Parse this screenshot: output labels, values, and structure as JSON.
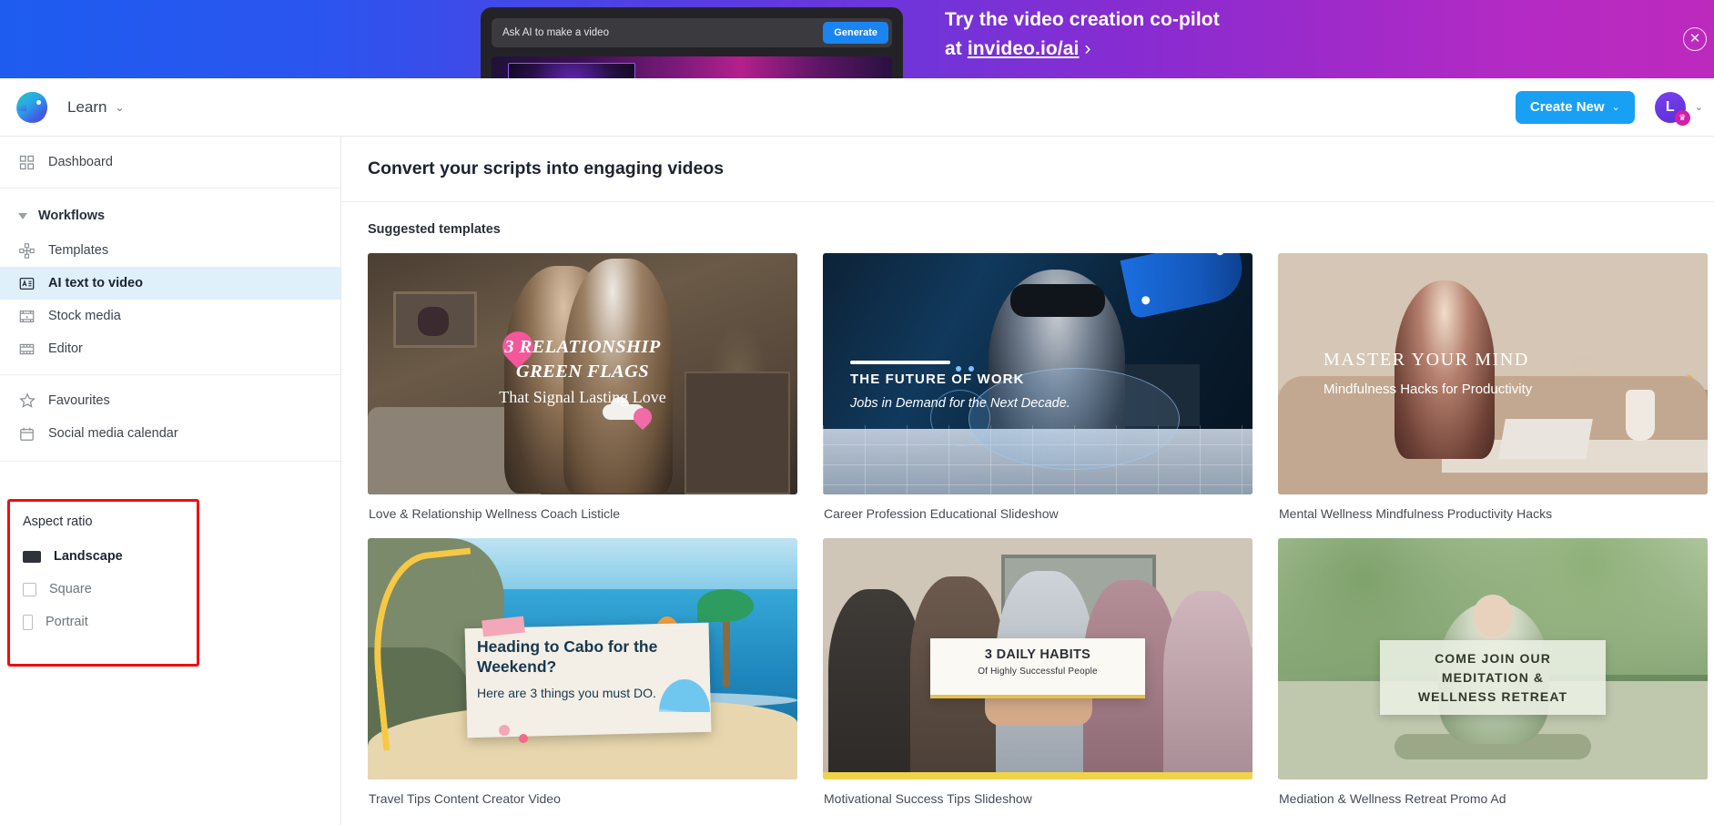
{
  "promo": {
    "prompt_placeholder": "Ask AI to make a video",
    "generate_label": "Generate",
    "headline_line1": "Try the video creation co-pilot",
    "headline_prefix": "at ",
    "link_text": "invideo.io/ai",
    "chevron": "›",
    "close_glyph": "✕",
    "gradient_from": "#1e5cf0",
    "gradient_to": "#bd29bd"
  },
  "topbar": {
    "brand_name": "Learn",
    "brand_caret": "⌄",
    "create_new_label": "Create New",
    "create_new_caret": "⌄",
    "create_new_color": "#18a0f5",
    "avatar_initial": "L",
    "avatar_badge_glyph": "♛",
    "avatar_caret": "⌄"
  },
  "sidebar": {
    "top_items": [
      {
        "label": "Dashboard",
        "icon": "grid-icon"
      }
    ],
    "workflows_header": "Workflows",
    "workflow_items": [
      {
        "label": "Templates",
        "icon": "templates-icon",
        "active": false
      },
      {
        "label": "AI text to video",
        "icon": "text-to-video-icon",
        "active": true
      },
      {
        "label": "Stock media",
        "icon": "stock-media-icon",
        "active": false
      },
      {
        "label": "Editor",
        "icon": "film-strip-icon",
        "active": false
      }
    ],
    "bottom_items": [
      {
        "label": "Favourites",
        "icon": "star-icon"
      },
      {
        "label": "Social media calendar",
        "icon": "calendar-icon"
      }
    ],
    "active_highlight_color": "#dff0fb"
  },
  "aspect_ratio": {
    "title": "Aspect ratio",
    "highlight_color": "#f40b0b",
    "options": [
      {
        "label": "Landscape",
        "icon": "landscape-rect-icon",
        "selected": true
      },
      {
        "label": "Square",
        "icon": "square-rect-icon",
        "selected": false
      },
      {
        "label": "Portrait",
        "icon": "portrait-rect-icon",
        "selected": false
      }
    ]
  },
  "main": {
    "title": "Convert your scripts into engaging videos",
    "section_label": "Suggested templates",
    "templates": [
      {
        "label": "Love & Relationship Wellness Coach Listicle",
        "overlay": {
          "line1": "3 RELATIONSHIP",
          "line2": "GREEN FLAGS",
          "line3": "That Signal Lasting Love"
        }
      },
      {
        "label": "Career Profession Educational Slideshow",
        "overlay": {
          "line1": "THE FUTURE OF WORK",
          "line2": "Jobs in Demand for the Next Decade."
        }
      },
      {
        "label": "Mental Wellness Mindfulness Productivity Hacks",
        "overlay": {
          "line1": "MASTER YOUR MIND",
          "line2": "Mindfulness Hacks for Productivity"
        }
      },
      {
        "label": "Travel Tips Content Creator Video",
        "overlay": {
          "line1": "Heading to Cabo for the Weekend?",
          "line2": "Here are 3 things you must DO."
        }
      },
      {
        "label": "Motivational Success Tips Slideshow",
        "overlay": {
          "line1": "3 DAILY HABITS",
          "line2": "Of Highly Successful People"
        }
      },
      {
        "label": "Mediation & Wellness Retreat Promo Ad",
        "overlay": {
          "line1": "COME JOIN OUR",
          "line2": "MEDITATION &",
          "line3": "WELLNESS RETREAT"
        }
      }
    ]
  }
}
